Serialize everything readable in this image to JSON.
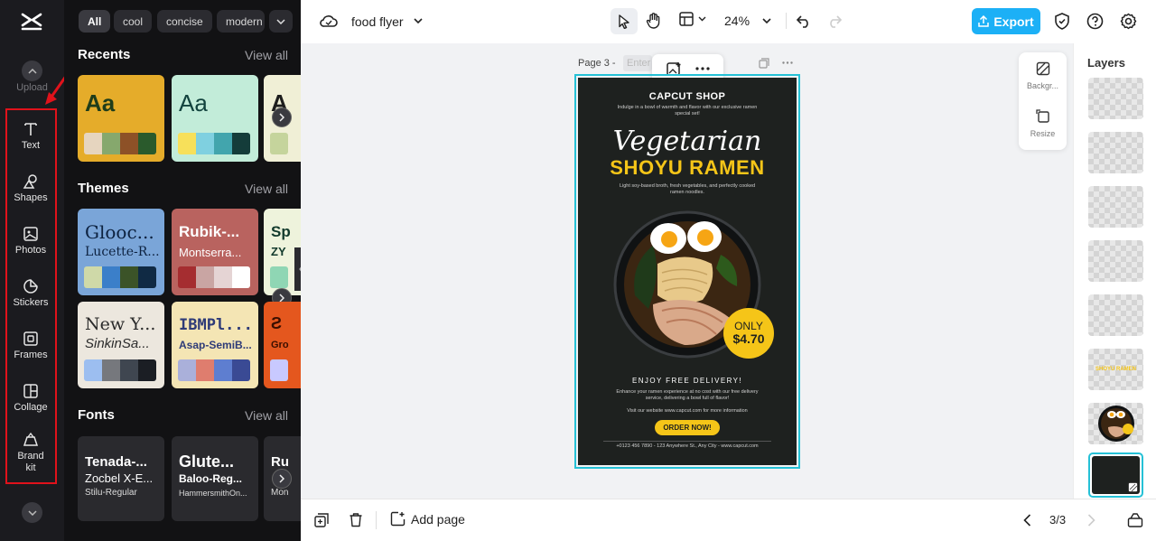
{
  "rail": {
    "upload_label": "Upload",
    "items": [
      {
        "label": "Text",
        "icon": "text-icon"
      },
      {
        "label": "Shapes",
        "icon": "shapes-icon"
      },
      {
        "label": "Photos",
        "icon": "photos-icon"
      },
      {
        "label": "Stickers",
        "icon": "stickers-icon"
      },
      {
        "label": "Frames",
        "icon": "frames-icon"
      },
      {
        "label": "Collage",
        "icon": "collage-icon"
      },
      {
        "label": "Brand kit",
        "icon": "brand-kit-icon"
      }
    ],
    "highlight_color": "#e0121b"
  },
  "panel": {
    "chips": [
      "All",
      "cool",
      "concise",
      "modern"
    ],
    "recents": {
      "title": "Recents",
      "view_all": "View all",
      "cards": [
        {
          "sample": "Aa",
          "bg": "#e5ac2a",
          "fg": "#1f3d1a",
          "swatches": [
            "#e6d5bf",
            "#86a86d",
            "#8d5127",
            "#2a5a2c"
          ]
        },
        {
          "sample": "Aa",
          "bg": "#c2ecd9",
          "fg": "#12433e",
          "swatches": [
            "#f7e05a",
            "#7fd0e0",
            "#42a5ad",
            "#143c3a"
          ]
        },
        {
          "sample": "A",
          "bg": "#f0efd6",
          "fg": "#1d1d1d",
          "swatches": [
            "#c5d49c"
          ]
        }
      ]
    },
    "themes": {
      "title": "Themes",
      "view_all": "View all",
      "cards": [
        {
          "heading": "Glooc...",
          "sub": "Lucette-R...",
          "bg": "#7aa5d8",
          "fg": "#0d2240",
          "swatches": [
            "#cfd9a8",
            "#3b7fc9",
            "#3b5328",
            "#102a44"
          ]
        },
        {
          "heading": "Rubik-...",
          "sub": "Montserra...",
          "bg": "#b9635f",
          "fg": "#ffffff",
          "swatches": [
            "#a52d30",
            "#c9a5a3",
            "#e5d4d4",
            "#ffffff"
          ]
        },
        {
          "heading": "Sp",
          "sub": "ZY",
          "bg": "#eef3dc",
          "fg": "#123a2c",
          "swatches": [
            "#8fd6b4"
          ]
        },
        {
          "heading": "New Y...",
          "sub": "SinkinSa...",
          "bg": "#ece7de",
          "fg": "#2b2b2b",
          "swatches": [
            "#9cbef0",
            "#76787d",
            "#3f4650",
            "#1b1e24"
          ]
        },
        {
          "heading": "IBMPl...",
          "sub": "Asap-SemiB...",
          "bg": "#f4e5b4",
          "fg": "#2e3b78",
          "swatches": [
            "#aab0da",
            "#df7d6e",
            "#5e7ed0",
            "#3a4a94"
          ]
        },
        {
          "heading": "Ƨ",
          "sub": "Gro",
          "bg": "#e4571e",
          "fg": "#3a0f00",
          "swatches": [
            "#c8c9ff"
          ]
        }
      ]
    },
    "fonts": {
      "title": "Fonts",
      "view_all": "View all",
      "cards": [
        {
          "line1": "Tenada-...",
          "line2": "Zocbel X-E...",
          "line3": "Stilu-Regular"
        },
        {
          "line1": "Glute...",
          "line2": "Baloo-Reg...",
          "line3": "HammersmithOn..."
        },
        {
          "line1": "Ru",
          "line2": "",
          "line3": "Mon"
        }
      ]
    }
  },
  "topbar": {
    "doc_title": "food flyer",
    "zoom": "24%",
    "export_label": "Export",
    "accent": "#1cb0f6"
  },
  "canvas": {
    "page_label": "Page 3 -",
    "page_name_placeholder": "Enter"
  },
  "flyer": {
    "shop": "CAPCUT SHOP",
    "intro": "Indulge in a bowl of warmth and flavor with our exclusive ramen special set!",
    "script_title": "Vegetarian",
    "main_title": "SHOYU RAMEN",
    "desc": "Light soy-based broth, fresh vegetables, and perfectly cooked ramen noodles.",
    "price_label": "ONLY",
    "price": "$4.70",
    "delivery": "ENJOY FREE DELIVERY!",
    "delivery_desc": "Enhance your ramen experience at no cost with our free delivery service, delivering a bowl full of flavor!",
    "visit": "Visit our website www.capcut.com for more information",
    "order_button": "ORDER NOW!",
    "footer": "+0123 456 7890 - 123 Anywhere St., Any City - www.capcut.com",
    "yellow": "#f5c518"
  },
  "side_tools": {
    "background_label": "Backgr...",
    "resize_label": "Resize"
  },
  "layers": {
    "title": "Layers",
    "thumb_text": "SHOYU RAMEN"
  },
  "bottombar": {
    "add_page_label": "Add page",
    "page_indicator": "3/3"
  }
}
